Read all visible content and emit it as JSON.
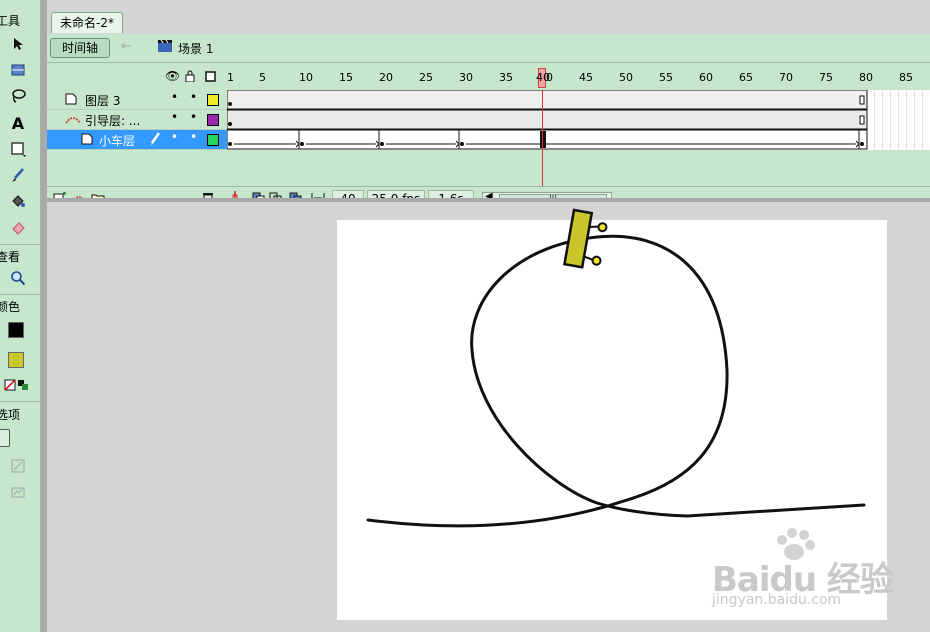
{
  "toolbox": {
    "tools_heading": "工具",
    "view_heading": "查看",
    "colors_heading": "颜色",
    "options_heading": "选项",
    "stroke_color": "#000000",
    "fill_color": "#c8c62a"
  },
  "document": {
    "tab_title": "未命名-2*"
  },
  "timeline_bar": {
    "toggle_label": "时间轴",
    "scene_label": "场景 1"
  },
  "ruler": {
    "labels": [
      "1",
      "5",
      "10",
      "15",
      "20",
      "25",
      "30",
      "35",
      "40",
      "45",
      "50",
      "55",
      "60",
      "65",
      "70",
      "75",
      "80",
      "85"
    ],
    "playhead_frame": 40,
    "playhead_label": "40"
  },
  "layers": [
    {
      "name": "图层 3",
      "type": "normal",
      "color": "#f0ea2a",
      "selected": false
    },
    {
      "name": "引导层: ...",
      "type": "guide",
      "color": "#9a2ab0",
      "selected": false
    },
    {
      "name": "小车层",
      "type": "guided",
      "color": "#2ad45a",
      "selected": true
    }
  ],
  "timeline_footer": {
    "current_frame": "40",
    "fps": "25.0 fps",
    "elapsed": "1.6s"
  },
  "watermark": {
    "brand": "Baidu 经验",
    "url": "jingyan.baidu.com"
  }
}
